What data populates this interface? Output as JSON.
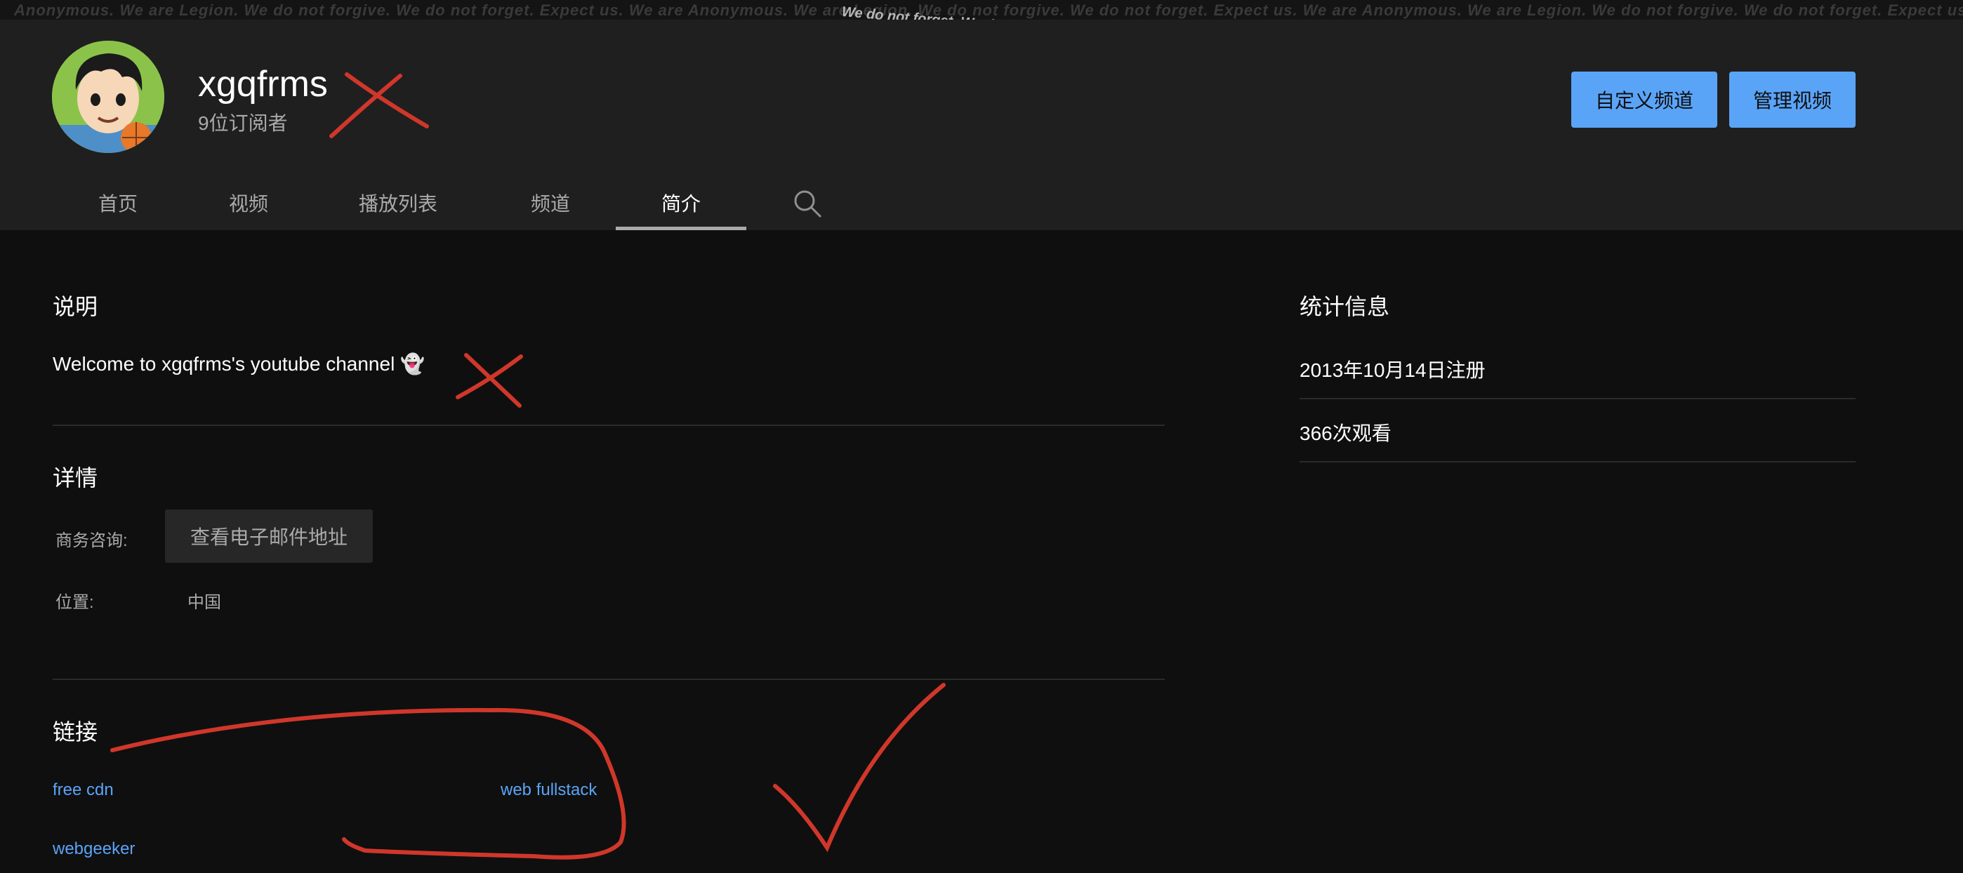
{
  "banner": {
    "text": "Anonymous. We are Legion. We do not forgive. We do not forget. Expect us. We are Anonymous. We are Legion. We do not forgive. We do not forget. Expect us. We are Anonymous. We are Legion. We do not forgive. We do not forget. Expect us.",
    "highlight": "We do not forget. We do not forgive. Expect us. We are Anonymous. We are Legion."
  },
  "channel": {
    "name": "xgqfrms",
    "subscribers": "9位订阅者"
  },
  "buttons": {
    "customize": "自定义频道",
    "manage": "管理视频"
  },
  "tabs": [
    {
      "label": "首页"
    },
    {
      "label": "视频"
    },
    {
      "label": "播放列表"
    },
    {
      "label": "频道"
    },
    {
      "label": "简介",
      "active": true
    }
  ],
  "description": {
    "title": "说明",
    "text": "Welcome to xgqfrms's youtube channel 👻"
  },
  "details": {
    "title": "详情",
    "business_label": "商务咨询:",
    "email_button": "查看电子邮件地址",
    "location_label": "位置:",
    "location_value": "中国"
  },
  "links": {
    "title": "链接",
    "items": [
      {
        "label": "free cdn"
      },
      {
        "label": "web fullstack"
      },
      {
        "label": "webgeeker"
      }
    ]
  },
  "stats": {
    "title": "统计信息",
    "joined": "2013年10月14日注册",
    "views": "366次观看"
  },
  "colors": {
    "accent": "#5aa4f8",
    "annotation": "#d0372a",
    "header_bg": "#1f1f1f",
    "page_bg": "#0f0f0f"
  }
}
